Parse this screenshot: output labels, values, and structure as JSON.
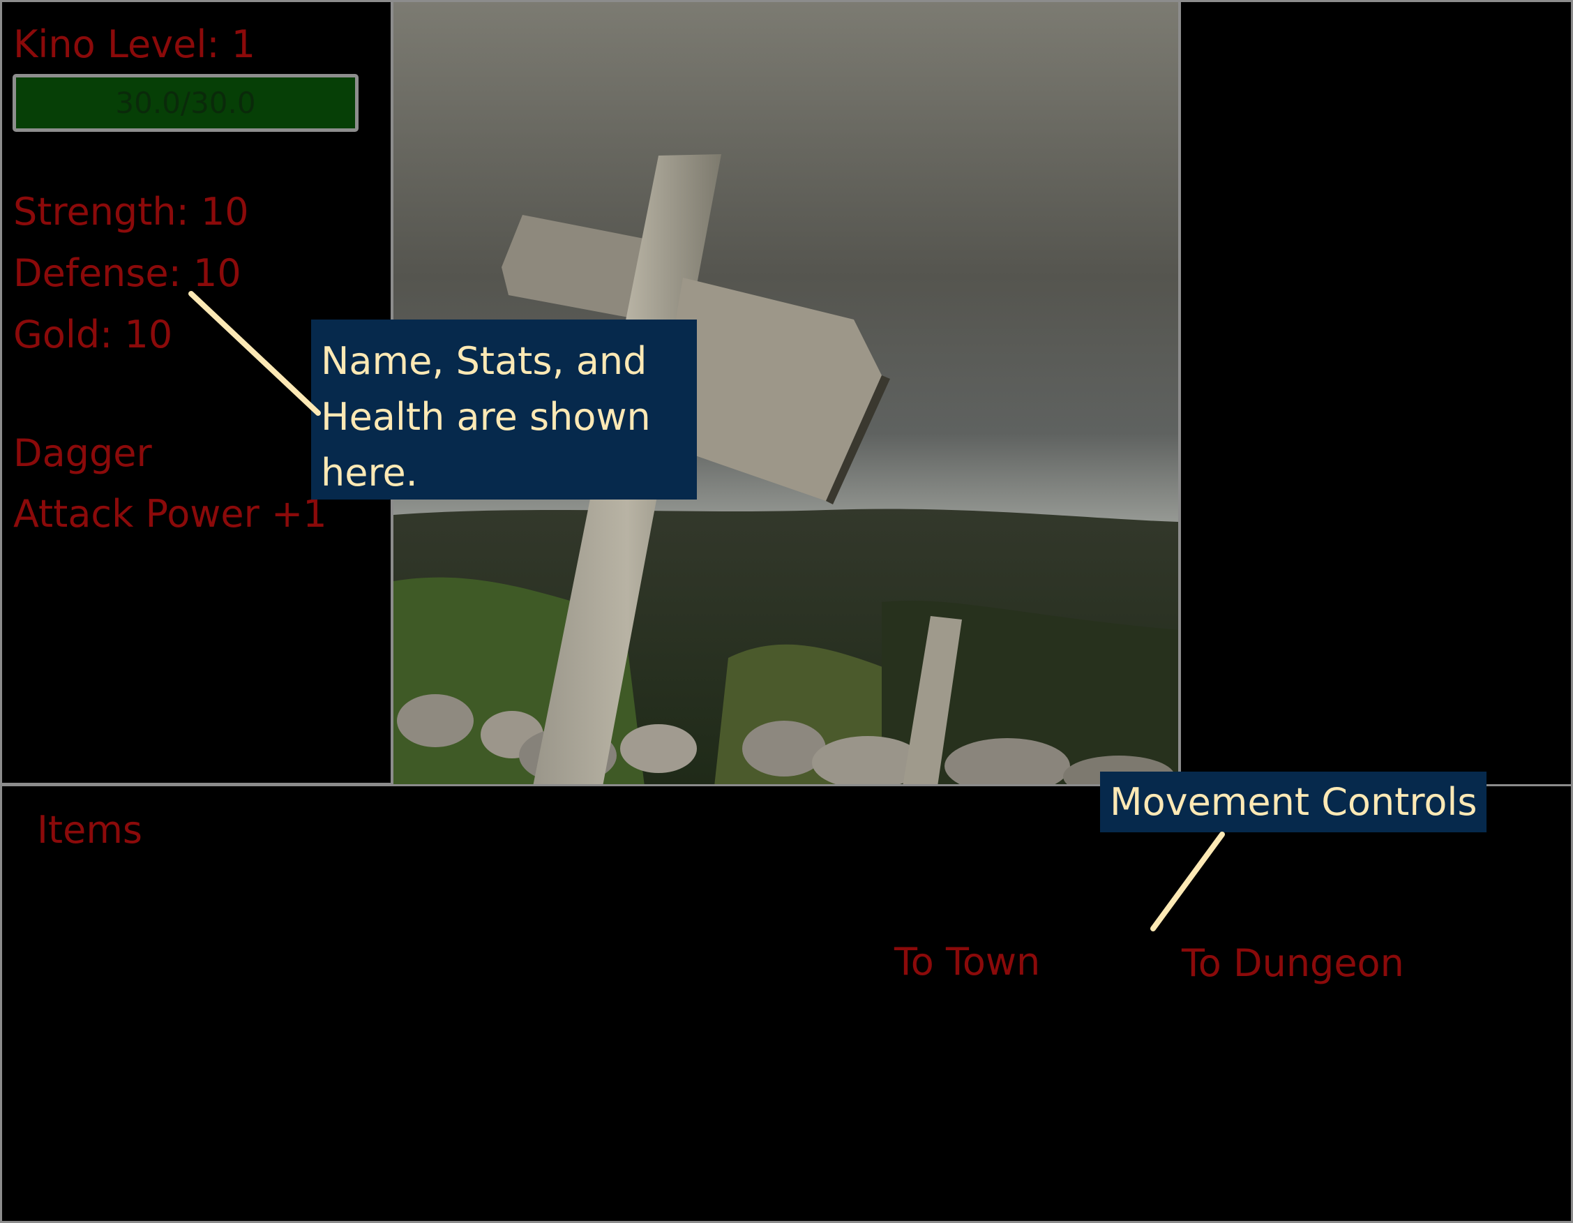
{
  "player": {
    "level_text": "Kino Level: 1",
    "health_text": "30.0/30.0",
    "health_fraction": 1.0,
    "strength_text": "Strength: 10",
    "defense_text": "Defense: 10",
    "gold_text": "Gold: 10"
  },
  "equipment": {
    "weapon_name": "Dagger",
    "weapon_bonus": "Attack Power +1"
  },
  "inventory": {
    "label": "Items"
  },
  "movement": {
    "to_town": "To Town",
    "to_dungeon": "To Dungeon"
  },
  "callouts": {
    "stats": "Name, Stats, and Health are shown here.",
    "movement": "Movement Controls"
  },
  "scene": {
    "icon": "signpost-scene"
  },
  "colors": {
    "text_red": "#8b0a0a",
    "health_green": "#063f06",
    "callout_bg": "#06294c",
    "callout_text": "#fde9b5"
  }
}
